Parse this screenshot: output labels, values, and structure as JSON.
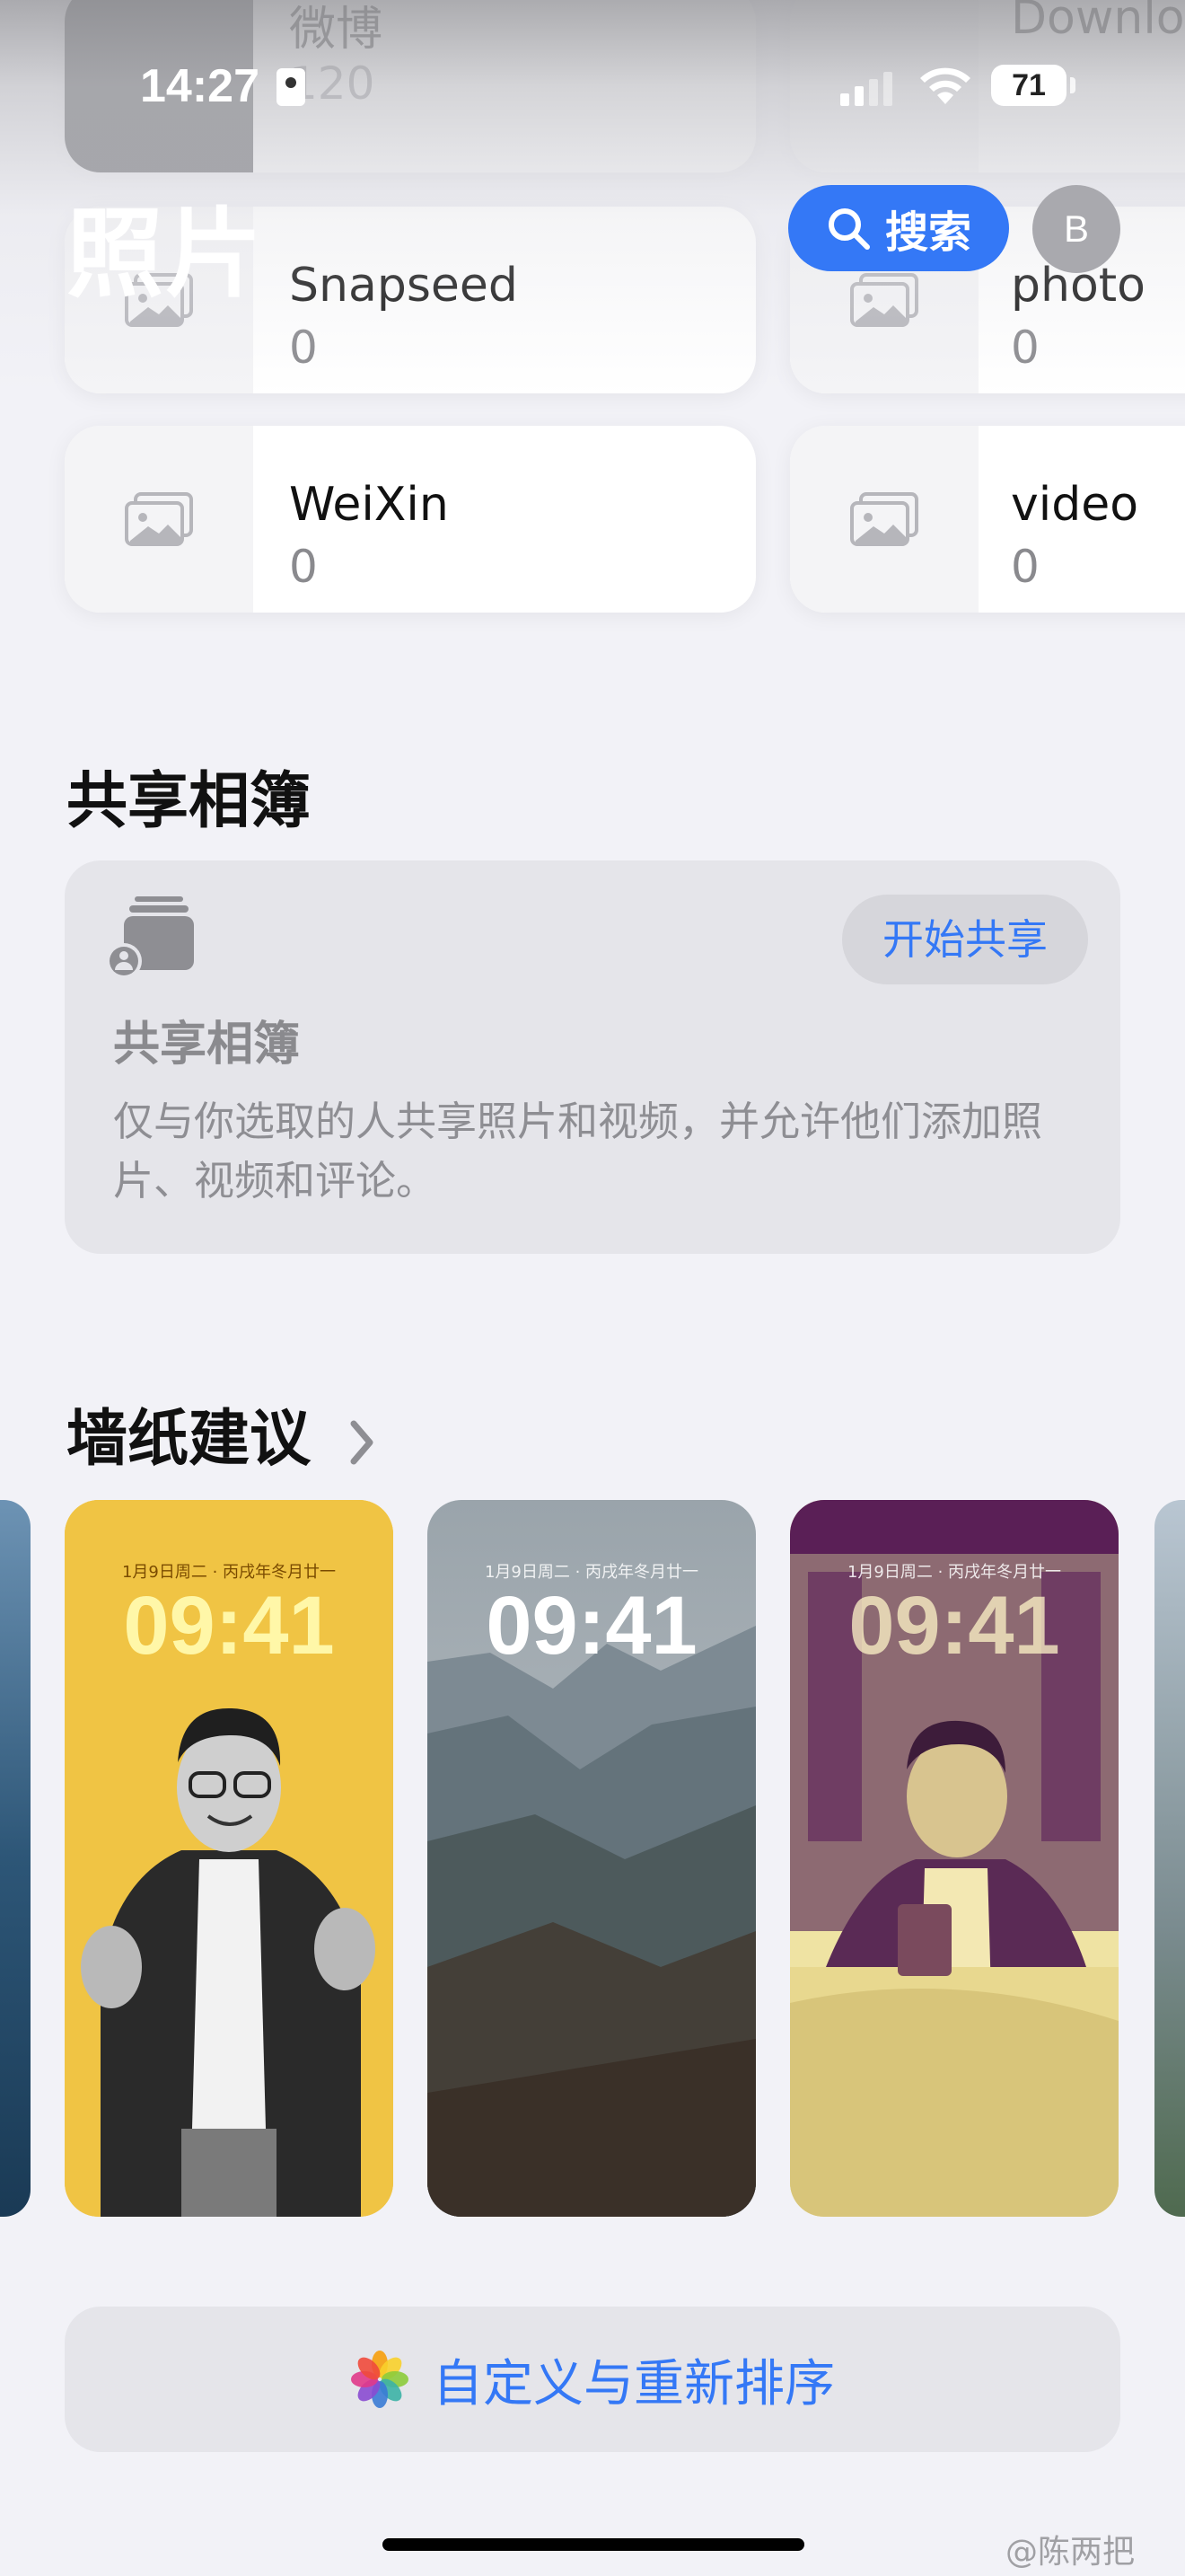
{
  "status_bar": {
    "time": "14:27",
    "battery": "71"
  },
  "header": {
    "title": "照片",
    "search_label": "搜索",
    "avatar_initial": "B"
  },
  "albums": [
    {
      "name": "微博",
      "count": "120"
    },
    {
      "name": "Downlo",
      "count": ""
    },
    {
      "name": "Snapseed",
      "count": "0"
    },
    {
      "name": "photo",
      "count": "0"
    },
    {
      "name": "WeiXin",
      "count": "0"
    },
    {
      "name": "video",
      "count": "0"
    }
  ],
  "shared_albums": {
    "section_title": "共享相簿",
    "card_title": "共享相簿",
    "start_button": "开始共享",
    "description": "仅与你选取的人共享照片和视频，并允许他们添加照片、视频和评论。"
  },
  "wallpaper_suggestions": {
    "section_title": "墙纸建议",
    "items": [
      {
        "date": "1月9日周二 · 丙戌年冬月廿一",
        "time": "09:41",
        "style": "yellow-portrait"
      },
      {
        "date": "1月9日周二 · 丙戌年冬月廿一",
        "time": "09:41",
        "style": "mountain-landscape"
      },
      {
        "date": "1月9日周二 · 丙戌年冬月廿一",
        "time": "09:41",
        "style": "duotone-purple-yellow"
      }
    ]
  },
  "customize": {
    "label": "自定义与重新排序",
    "icon": "photos-app-icon"
  },
  "watermark": "@陈两把",
  "colors": {
    "accent": "#3478f6",
    "background": "#f2f2f7",
    "card": "#e5e5ea"
  }
}
